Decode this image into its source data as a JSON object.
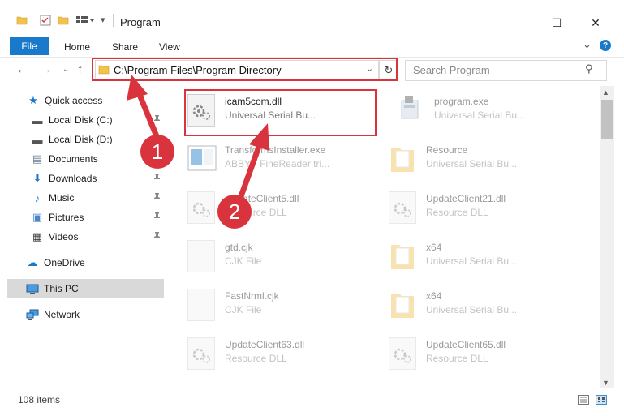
{
  "window": {
    "title": "Program",
    "minimize_glyph": "—",
    "maximize_glyph": "☐",
    "close_glyph": "✕"
  },
  "ribbon": {
    "tabs": [
      "File",
      "Home",
      "Share",
      "View"
    ],
    "expand_glyph": "⌄",
    "help_glyph": "?"
  },
  "nav": {
    "back_glyph": "←",
    "forward_glyph": "→",
    "recent_glyph": "⌄",
    "up_glyph": "↑"
  },
  "address": {
    "path": "C:\\Program Files\\Program Directory",
    "chevron_glyph": "⌄",
    "refresh_glyph": "↻"
  },
  "search": {
    "placeholder": "Search Program",
    "icon_glyph": "⚲"
  },
  "sidebar": {
    "items": [
      {
        "label": "Quick access",
        "icon": "star-icon",
        "glyph": "★",
        "color": "#1979ca"
      },
      {
        "label": "Local Disk (C:)",
        "icon": "drive-icon",
        "glyph": "▬",
        "color": "#555555",
        "pinned": true
      },
      {
        "label": "Local Disk (D:)",
        "icon": "drive-icon",
        "glyph": "▬",
        "color": "#555555"
      },
      {
        "label": "Documents",
        "icon": "documents-icon",
        "glyph": "▤",
        "color": "#6b7b8c",
        "pinned": true
      },
      {
        "label": "Downloads",
        "icon": "download-icon",
        "glyph": "⬇",
        "color": "#1979ca",
        "pinned": true
      },
      {
        "label": "Music",
        "icon": "music-icon",
        "glyph": "♪",
        "color": "#1979ca",
        "pinned": true
      },
      {
        "label": "Pictures",
        "icon": "pictures-icon",
        "glyph": "▣",
        "color": "#4a86c8",
        "pinned": true
      },
      {
        "label": "Videos",
        "icon": "videos-icon",
        "glyph": "▦",
        "color": "#333333",
        "pinned": true
      },
      {
        "label": "OneDrive",
        "icon": "cloud-icon",
        "glyph": "☁",
        "color": "#1979ca"
      },
      {
        "label": "This PC",
        "icon": "computer-icon",
        "glyph": "▭",
        "color": "#1979ca"
      },
      {
        "label": "Network",
        "icon": "network-icon",
        "glyph": "⊞",
        "color": "#1979ca"
      }
    ],
    "pin_glyph": "📌"
  },
  "files": [
    {
      "name": "icam5com.dll",
      "desc": "Universal Serial Bu...",
      "type": "dll",
      "highlighted": true
    },
    {
      "name": "program.exe",
      "desc": "Universal Serial Bu...",
      "type": "exe"
    },
    {
      "name": "TransformsInstaller.exe",
      "desc": "ABBYY FineReader tri...",
      "type": "app"
    },
    {
      "name": "Resource",
      "desc": "Universal Serial Bu...",
      "type": "folder"
    },
    {
      "name": "UpdateClient5.dll",
      "desc": "Resource DLL",
      "type": "dll"
    },
    {
      "name": "UpdateClient21.dll",
      "desc": "Resource DLL",
      "type": "dll"
    },
    {
      "name": "gtd.cjk",
      "desc": "CJK File",
      "type": "file"
    },
    {
      "name": "x64",
      "desc": "Universal Serial Bu...",
      "type": "folder"
    },
    {
      "name": "FastNrml.cjk",
      "desc": "CJK File",
      "type": "file"
    },
    {
      "name": "x64",
      "desc": "Universal Serial Bu...",
      "type": "folder"
    },
    {
      "name": "UpdateClient63.dll",
      "desc": "Resource DLL",
      "type": "dll"
    },
    {
      "name": "UpdateClient65.dll",
      "desc": "Resource DLL",
      "type": "dll"
    }
  ],
  "status": {
    "item_count": "108 items"
  },
  "annotations": {
    "step1": "1",
    "step2": "2",
    "color": "#d9343d"
  }
}
